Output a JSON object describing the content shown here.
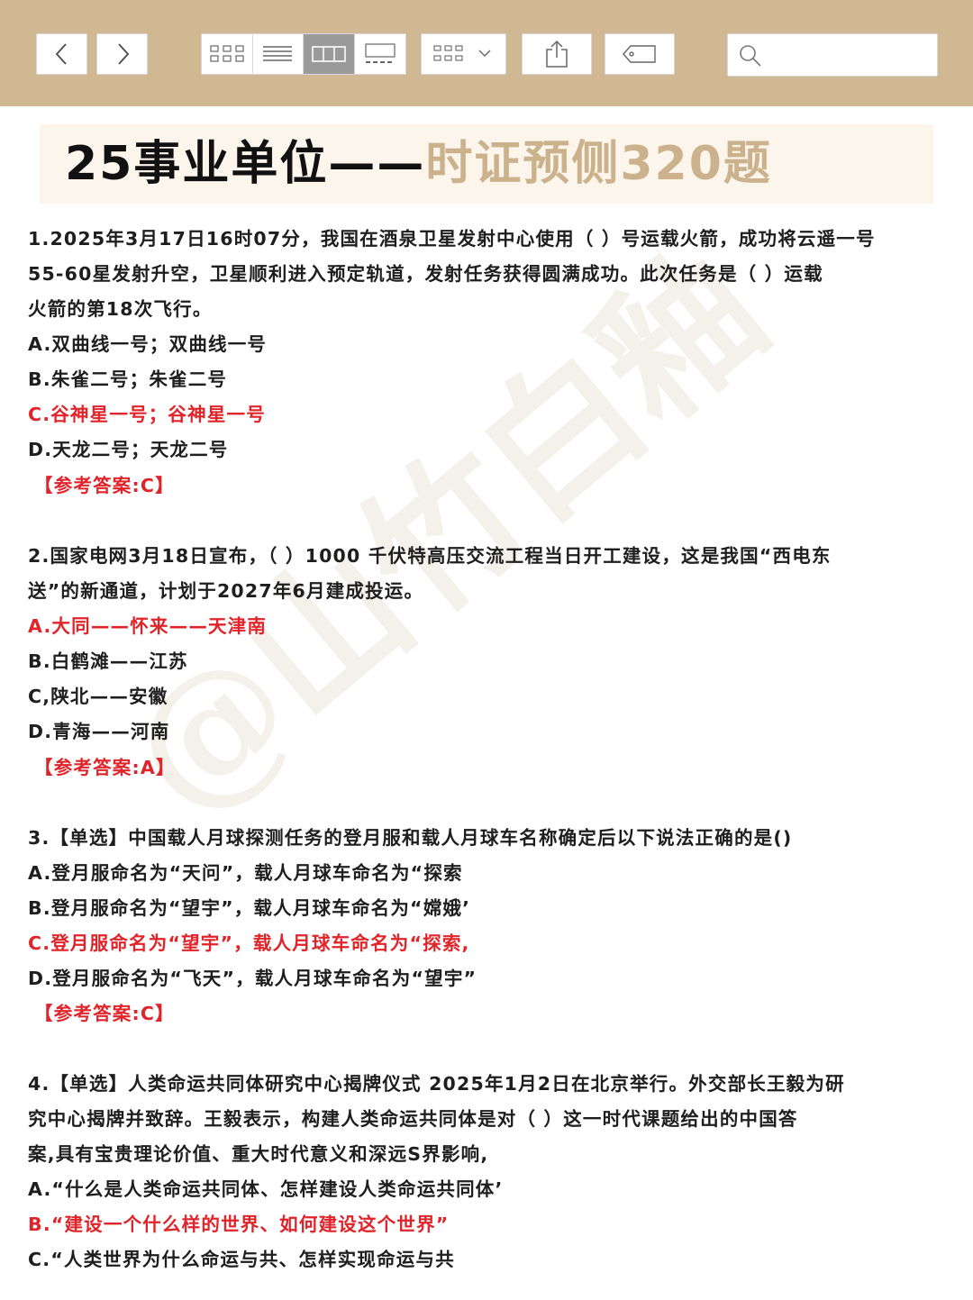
{
  "toolbar": {
    "back": "chevron-left-icon",
    "forward": "chevron-right-icon",
    "view_modes": [
      "grid-view-icon",
      "list-view-icon",
      "column-view-icon",
      "gallery-view-icon"
    ],
    "group_menu": "group-by-icon",
    "share": "share-icon",
    "tag": "tag-icon",
    "search_placeholder": "",
    "accent": "#cfb892"
  },
  "title": {
    "part1": "25事业单位——",
    "part2": "时证预侧320题"
  },
  "watermark": "@山竹白釉",
  "questions": [
    {
      "lines": [
        "1.2025年3月17日16时07分，我国在酒泉卫星发射中心使用（ ）号运载火箭，成功将云遥一号",
        "55-60星发射升空，卫星顺利进入预定轨道，发射任务获得圆满成功。此次任务是（ ）运载",
        "火箭的第18次飞行。"
      ],
      "options": [
        {
          "text": "A.双曲线一号；双曲线一号",
          "correct": false
        },
        {
          "text": "B.朱雀二号；朱雀二号",
          "correct": false
        },
        {
          "text": "C.谷神星一号；谷神星一号",
          "correct": true
        },
        {
          "text": "D.天龙二号；天龙二号",
          "correct": false
        }
      ],
      "answer": "【参考答案:C】"
    },
    {
      "lines": [
        "2.国家电网3月18日宣布，（ ）1000 千伏特高压交流工程当日开工建设，这是我国“西电东",
        "送”的新通道，计划于2027年6月建成投运。"
      ],
      "options": [
        {
          "text": "A.大同——怀来——天津南",
          "correct": true
        },
        {
          "text": "B.白鹤滩——江苏",
          "correct": false
        },
        {
          "text": "C,陕北——安徽",
          "correct": false
        },
        {
          "text": "D.青海——河南",
          "correct": false
        }
      ],
      "answer": "【参考答案:A】"
    },
    {
      "lines": [
        "3.【单选】中国载人月球探测任务的登月服和载人月球车名称确定后以下说法正确的是()"
      ],
      "options": [
        {
          "text": "A.登月服命名为“天问”，载人月球车命名为“探索",
          "correct": false
        },
        {
          "text": "B.登月服命名为“望宇”，载人月球车命名为“嫦娥’",
          "correct": false
        },
        {
          "text": "C.登月服命名为“望宇”，载人月球车命名为“探索,",
          "correct": true
        },
        {
          "text": "D.登月服命名为“飞天”，载人月球车命名为“望宇”",
          "correct": false
        }
      ],
      "answer": "【参考答案:C】"
    },
    {
      "lines": [
        "4.【单选】人类命运共同体研究中心揭牌仪式 2025年1月2日在北京举行。外交部长王毅为研",
        "究中心揭牌并致辞。王毅表示，构建人类命运共同体是对（ ）这一时代课题给出的中国答",
        "案,具有宝贵理论价值、重大时代意义和深远S界影响,"
      ],
      "options": [
        {
          "text": "A.“什么是人类命运共同体、怎样建设人类命运共同体’",
          "correct": false
        },
        {
          "text": "B.“建设一个什么样的世界、如何建设这个世界”",
          "correct": true
        },
        {
          "text": "C.“人类世界为什么命运与共、怎样实现命运与共",
          "correct": false
        }
      ]
    }
  ]
}
